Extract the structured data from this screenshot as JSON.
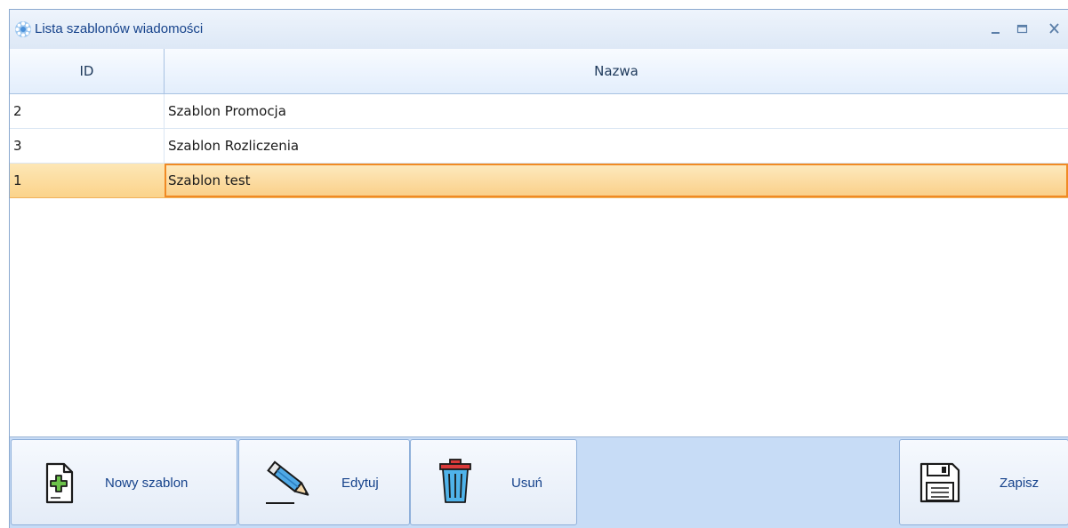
{
  "window": {
    "title": "Lista szablonów wiadomości",
    "app_icon": "gear-flower-icon",
    "controls": [
      "minimize-icon",
      "maximize-icon",
      "close-icon"
    ]
  },
  "grid": {
    "columns": [
      "ID",
      "Nazwa"
    ],
    "rows": [
      {
        "id": "2",
        "name": "Szablon Promocja",
        "selected": false
      },
      {
        "id": "3",
        "name": "Szablon Rozliczenia",
        "selected": false
      },
      {
        "id": "1",
        "name": "Szablon test",
        "selected": true
      }
    ]
  },
  "toolbar": {
    "new_label": "Nowy szablon",
    "edit_label": "Edytuj",
    "delete_label": "Usuń",
    "save_label": "Zapisz"
  },
  "colors": {
    "title_text": "#15428b",
    "selection": "#fbd38a",
    "selection_border": "#f08a24",
    "toolbar_bg": "#c7dcf6"
  }
}
